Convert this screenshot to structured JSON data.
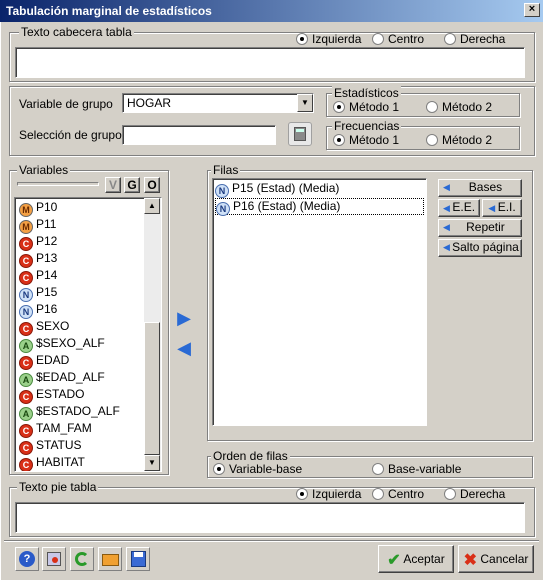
{
  "window": {
    "title": "Tabulación marginal de estadísticos",
    "close": "×"
  },
  "header_text": {
    "legend": "Texto cabecera tabla",
    "value": "",
    "options": [
      "Izquierda",
      "Centro",
      "Derecha"
    ],
    "selected": "Izquierda"
  },
  "group": {
    "variable_label": "Variable de grupo",
    "variable_value": "HOGAR",
    "selection_label": "Selección de grupo",
    "selection_value": ""
  },
  "estadisticos": {
    "legend": "Estadísticos",
    "options": [
      "Método 1",
      "Método 2"
    ],
    "selected": "Método 1"
  },
  "frecuencias": {
    "legend": "Frecuencias",
    "options": [
      "Método 1",
      "Método 2"
    ],
    "selected": "Método 1"
  },
  "variables": {
    "legend": "Variables",
    "filters": [
      "V",
      "G",
      "O"
    ],
    "items": [
      {
        "badge": "M",
        "name": "P10"
      },
      {
        "badge": "M",
        "name": "P11"
      },
      {
        "badge": "C",
        "name": "P12"
      },
      {
        "badge": "C",
        "name": "P13"
      },
      {
        "badge": "C",
        "name": "P14"
      },
      {
        "badge": "N",
        "name": "P15"
      },
      {
        "badge": "N",
        "name": "P16"
      },
      {
        "badge": "C",
        "name": "SEXO"
      },
      {
        "badge": "A",
        "name": "$SEXO_ALF"
      },
      {
        "badge": "C",
        "name": "EDAD"
      },
      {
        "badge": "A",
        "name": "$EDAD_ALF"
      },
      {
        "badge": "C",
        "name": "ESTADO"
      },
      {
        "badge": "A",
        "name": "$ESTADO_ALF"
      },
      {
        "badge": "C",
        "name": "TAM_FAM"
      },
      {
        "badge": "C",
        "name": "STATUS"
      },
      {
        "badge": "C",
        "name": "HABITAT"
      }
    ]
  },
  "filas": {
    "legend": "Filas",
    "items": [
      {
        "badge": "N",
        "text": "P15  (Estad)  (Media)"
      },
      {
        "badge": "N",
        "text": "P16  (Estad)  (Media)"
      }
    ],
    "buttons": {
      "bases": "Bases",
      "ee": "E.E.",
      "ei": "E.I.",
      "repetir": "Repetir",
      "salto": "Salto página"
    }
  },
  "orden": {
    "legend": "Orden de filas",
    "options": [
      "Variable-base",
      "Base-variable"
    ],
    "selected": "Variable-base"
  },
  "footer_text": {
    "legend": "Texto pie tabla",
    "value": "",
    "options": [
      "Izquierda",
      "Centro",
      "Derecha"
    ],
    "selected": "Izquierda"
  },
  "bottom": {
    "accept": "Aceptar",
    "cancel": "Cancelar"
  }
}
